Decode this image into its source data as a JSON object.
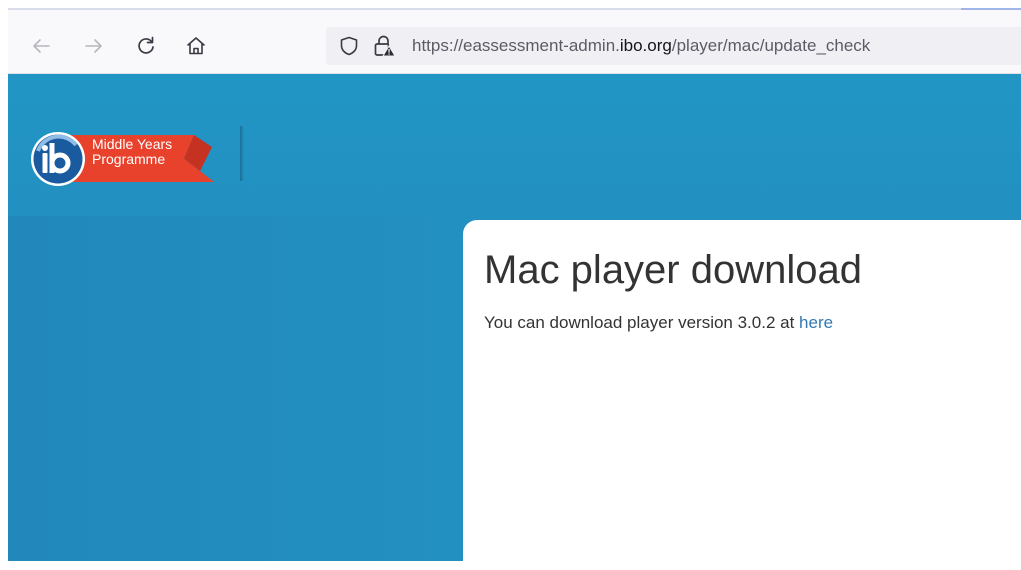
{
  "browser": {
    "nav": {
      "back_icon": "arrow-left-icon",
      "forward_icon": "arrow-right-icon",
      "reload_icon": "reload-icon",
      "home_icon": "home-icon"
    },
    "address_bar": {
      "prefix": "https://eassessment-admin.",
      "domain": "ibo.org",
      "path": "/player/mac/update_check",
      "security_icon": "shield-icon",
      "lock_icon": "lock-warning-icon"
    }
  },
  "logo": {
    "line1": "Middle Years",
    "line2": "Programme",
    "ribbon_color": "#e8412c",
    "seal_color": "#1a5a9e"
  },
  "content": {
    "title": "Mac player download",
    "body_prefix": "You can download player version 3.0.2 at ",
    "link_text": "here"
  },
  "colors": {
    "page_background": "#2290c1",
    "link": "#337ab7",
    "text": "#333333"
  }
}
